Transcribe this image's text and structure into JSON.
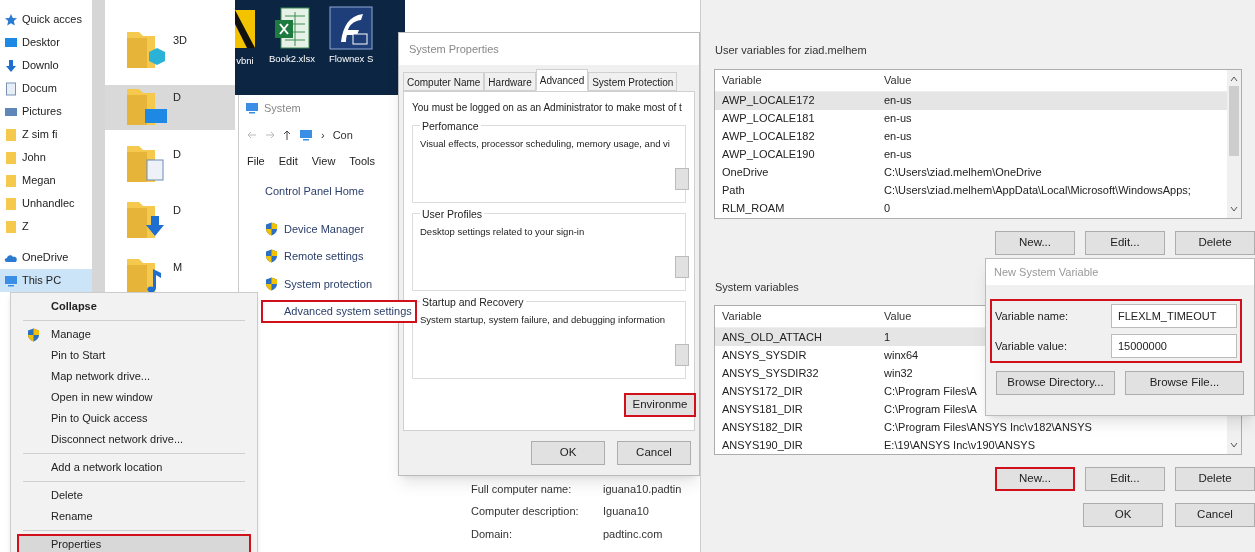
{
  "explorer": {
    "nav_items": [
      {
        "label": "Quick acces",
        "kind": "star",
        "selected": false
      },
      {
        "label": "Desktor",
        "kind": "desktop",
        "selected": false
      },
      {
        "label": "Downlo",
        "kind": "download",
        "selected": false
      },
      {
        "label": "Docum",
        "kind": "document",
        "selected": false
      },
      {
        "label": "Pictures",
        "kind": "pictures",
        "selected": false
      },
      {
        "label": "Z sim fi",
        "kind": "folder",
        "selected": false
      },
      {
        "label": "John",
        "kind": "folder",
        "selected": false
      },
      {
        "label": "Megan",
        "kind": "folder",
        "selected": false
      },
      {
        "label": "Unhandlec",
        "kind": "folder",
        "selected": false
      },
      {
        "label": "Z",
        "kind": "folder",
        "selected": false
      },
      {
        "label": "OneDrive",
        "kind": "cloud",
        "selected": false
      },
      {
        "label": "This PC",
        "kind": "pc",
        "selected": true
      }
    ],
    "folders": [
      {
        "label": "3D",
        "kind": "cube",
        "selected": false
      },
      {
        "label": "D",
        "kind": "desktop",
        "selected": true
      },
      {
        "label": "D",
        "kind": "document",
        "selected": false
      },
      {
        "label": "D",
        "kind": "download",
        "selected": false
      },
      {
        "label": "M",
        "kind": "music",
        "selected": false
      }
    ]
  },
  "desktop": {
    "icons": [
      {
        "label": "vbni",
        "kind": "app"
      },
      {
        "label": "Book2.xlsx",
        "kind": "excel"
      },
      {
        "label": "Flownex S",
        "kind": "flownex"
      }
    ]
  },
  "context_menu": {
    "items": [
      {
        "kind": "item",
        "label": "Collapse",
        "bold": true,
        "shield": false,
        "selected": false,
        "highlighted": false
      },
      {
        "kind": "separator"
      },
      {
        "kind": "item",
        "label": "Manage",
        "bold": false,
        "shield": true,
        "selected": false,
        "highlighted": false
      },
      {
        "kind": "item",
        "label": "Pin to Start",
        "bold": false,
        "shield": false,
        "selected": false,
        "highlighted": false
      },
      {
        "kind": "item",
        "label": "Map network drive...",
        "bold": false,
        "shield": false,
        "selected": false,
        "highlighted": false
      },
      {
        "kind": "item",
        "label": "Open in new window",
        "bold": false,
        "shield": false,
        "selected": false,
        "highlighted": false
      },
      {
        "kind": "item",
        "label": "Pin to Quick access",
        "bold": false,
        "shield": false,
        "selected": false,
        "highlighted": false
      },
      {
        "kind": "item",
        "label": "Disconnect network drive...",
        "bold": false,
        "shield": false,
        "selected": false,
        "highlighted": false
      },
      {
        "kind": "separator"
      },
      {
        "kind": "item",
        "label": "Add a network location",
        "bold": false,
        "shield": false,
        "selected": false,
        "highlighted": false
      },
      {
        "kind": "separator"
      },
      {
        "kind": "item",
        "label": "Delete",
        "bold": false,
        "shield": false,
        "selected": false,
        "highlighted": false
      },
      {
        "kind": "item",
        "label": "Rename",
        "bold": false,
        "shield": false,
        "selected": false,
        "highlighted": false
      },
      {
        "kind": "separator"
      },
      {
        "kind": "item",
        "label": "Properties",
        "bold": false,
        "shield": false,
        "selected": true,
        "highlighted": true
      }
    ]
  },
  "system_window": {
    "title": "System",
    "address": "Con",
    "address_separator": "›",
    "menu": [
      "File",
      "Edit",
      "View",
      "Tools"
    ],
    "home_link": "Control Panel Home",
    "links": [
      {
        "label": "Device Manager",
        "shield": true,
        "highlighted": false
      },
      {
        "label": "Remote settings",
        "shield": true,
        "highlighted": false
      },
      {
        "label": "System protection",
        "shield": true,
        "highlighted": false
      },
      {
        "label": "Advanced system settings",
        "shield": false,
        "highlighted": true
      }
    ],
    "info": [
      {
        "label": "Full computer name:",
        "value": "iguana10.padtin"
      },
      {
        "label": "Computer description:",
        "value": "Iguana10"
      },
      {
        "label": "Domain:",
        "value": "padtinc.com"
      }
    ]
  },
  "system_properties": {
    "title": "System Properties",
    "tabs": [
      {
        "label": "Computer Name",
        "selected": false
      },
      {
        "label": "Hardware",
        "selected": false
      },
      {
        "label": "Advanced",
        "selected": true
      },
      {
        "label": "System Protection",
        "selected": false
      }
    ],
    "notice": "You must be logged on as an Administrator to make most of t",
    "groups": [
      {
        "title": "Perfomance",
        "text": "Visual effects, processor scheduling, memory usage, and vi"
      },
      {
        "title": "User Profiles",
        "text": "Desktop settings related to your sign-in"
      },
      {
        "title": "Startup and Recovery",
        "text": "System startup, system failure, and debugging information"
      }
    ],
    "env_button": {
      "label": "Environme",
      "highlighted": true
    },
    "buttons": [
      "OK",
      "Cancel"
    ]
  },
  "environment_variables": {
    "user_section": {
      "title": "User variables for ziad.melhem",
      "columns": [
        "Variable",
        "Value"
      ],
      "rows": [
        {
          "variable": "AWP_LOCALE172",
          "value": "en-us",
          "selected": true
        },
        {
          "variable": "AWP_LOCALE181",
          "value": "en-us",
          "selected": false
        },
        {
          "variable": "AWP_LOCALE182",
          "value": "en-us",
          "selected": false
        },
        {
          "variable": "AWP_LOCALE190",
          "value": "en-us",
          "selected": false
        },
        {
          "variable": "OneDrive",
          "value": "C:\\Users\\ziad.melhem\\OneDrive",
          "selected": false
        },
        {
          "variable": "Path",
          "value": "C:\\Users\\ziad.melhem\\AppData\\Local\\Microsoft\\WindowsApps;",
          "selected": false
        },
        {
          "variable": "RLM_ROAM",
          "value": "0",
          "selected": false
        }
      ],
      "buttons": [
        {
          "label": "New...",
          "highlighted": false
        },
        {
          "label": "Edit...",
          "highlighted": false
        },
        {
          "label": "Delete",
          "highlighted": false
        }
      ]
    },
    "system_section": {
      "title": "System variables",
      "columns": [
        "Variable",
        "Value"
      ],
      "rows": [
        {
          "variable": "ANS_OLD_ATTACH",
          "value": "1",
          "selected": true
        },
        {
          "variable": "ANSYS_SYSDIR",
          "value": "winx64",
          "selected": false
        },
        {
          "variable": "ANSYS_SYSDIR32",
          "value": "win32",
          "selected": false
        },
        {
          "variable": "ANSYS172_DIR",
          "value": "C:\\Program Files\\A",
          "selected": false
        },
        {
          "variable": "ANSYS181_DIR",
          "value": "C:\\Program Files\\A",
          "selected": false
        },
        {
          "variable": "ANSYS182_DIR",
          "value": "C:\\Program Files\\ANSYS Inc\\v182\\ANSYS",
          "selected": false
        },
        {
          "variable": "ANSYS190_DIR",
          "value": "E:\\19\\ANSYS Inc\\v190\\ANSYS",
          "selected": false
        }
      ],
      "buttons": [
        {
          "label": "New...",
          "highlighted": true
        },
        {
          "label": "Edit...",
          "highlighted": false
        },
        {
          "label": "Delete",
          "highlighted": false
        }
      ]
    },
    "buttons": [
      "OK",
      "Cancel"
    ]
  },
  "new_variable_dialog": {
    "title": "New System Variable",
    "fields_highlighted": true,
    "fields": [
      {
        "label": "Variable name:",
        "value": "FLEXLM_TIMEOUT"
      },
      {
        "label": "Variable value:",
        "value": "15000000"
      }
    ],
    "buttons": [
      "Browse Directory...",
      "Browse File..."
    ]
  }
}
